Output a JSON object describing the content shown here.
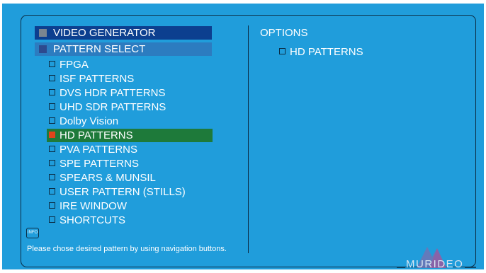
{
  "header": {
    "video_generator": "VIDEO GENERATOR",
    "pattern_select": "PATTERN SELECT"
  },
  "menu": {
    "items": [
      {
        "label": "FPGA",
        "selected": false
      },
      {
        "label": "ISF PATTERNS",
        "selected": false
      },
      {
        "label": "DVS HDR PATTERNS",
        "selected": false
      },
      {
        "label": "UHD SDR PATTERNS",
        "selected": false
      },
      {
        "label": "Dolby Vision",
        "selected": false
      },
      {
        "label": "HD PATTERNS",
        "selected": true
      },
      {
        "label": "PVA PATTERNS",
        "selected": false
      },
      {
        "label": "SPE PATTERNS",
        "selected": false
      },
      {
        "label": "SPEARS & MUNSIL",
        "selected": false
      },
      {
        "label": "USER PATTERN (STILLS)",
        "selected": false
      },
      {
        "label": "IRE WINDOW",
        "selected": false
      },
      {
        "label": "SHORTCUTS",
        "selected": false
      }
    ]
  },
  "options": {
    "title": "OPTIONS",
    "item_label": "HD PATTERNS"
  },
  "footer": {
    "info_label": "INFO",
    "hint": "Please chose desired pattern by using navigation buttons.",
    "logo_text": "MURIDEO"
  },
  "colors": {
    "background": "#209ddb",
    "header_primary": "#0c3f8f",
    "header_secondary": "#2c7cc0",
    "selected_row": "#1e7a3a",
    "selected_box": "#e0451b"
  }
}
